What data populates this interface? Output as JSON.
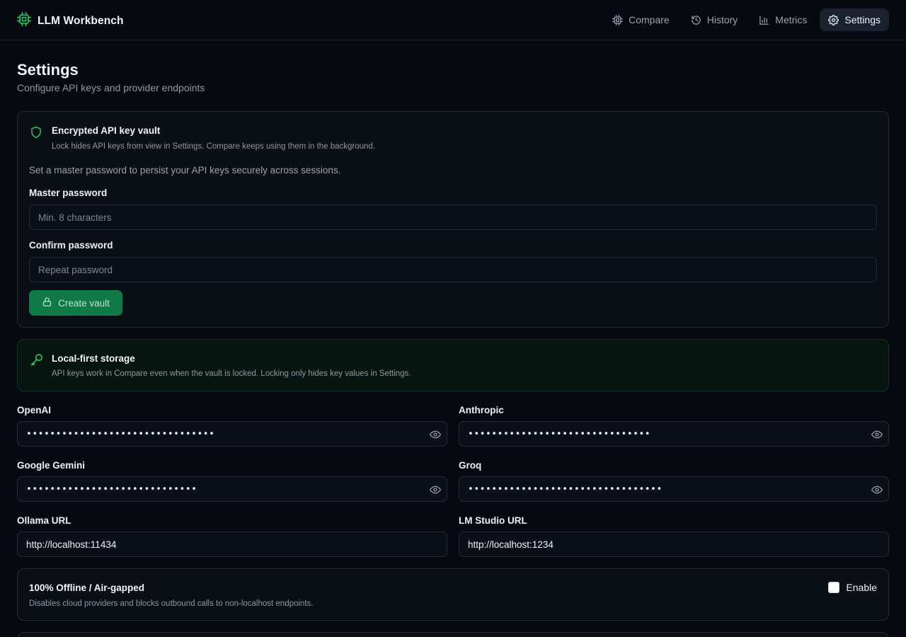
{
  "app": {
    "name": "LLM Workbench",
    "accent": "#22c55e"
  },
  "nav": {
    "items": [
      {
        "label": "Compare",
        "icon": "cpu-icon",
        "active": false
      },
      {
        "label": "History",
        "icon": "history-icon",
        "active": false
      },
      {
        "label": "Metrics",
        "icon": "bar-chart-icon",
        "active": false
      },
      {
        "label": "Settings",
        "icon": "gear-icon",
        "active": true
      }
    ]
  },
  "page": {
    "title": "Settings",
    "subtitle": "Configure API keys and provider endpoints"
  },
  "vault": {
    "title": "Encrypted API key vault",
    "description": "Lock hides API keys from view in Settings. Compare keeps using them in the background.",
    "intro": "Set a master password to persist your API keys securely across sessions.",
    "master_label": "Master password",
    "master_placeholder": "Min. 8 characters",
    "confirm_label": "Confirm password",
    "confirm_placeholder": "Repeat password",
    "create_label": "Create vault"
  },
  "local_storage": {
    "title": "Local-first storage",
    "description": "API keys work in Compare even when the vault is locked. Locking only hides key values in Settings."
  },
  "providers": {
    "openai": {
      "label": "OpenAI",
      "masked": "••••••••••••••••••••••••••••••••"
    },
    "anthropic": {
      "label": "Anthropic",
      "masked": "•••••••••••••••••••••••••••••••"
    },
    "gemini": {
      "label": "Google Gemini",
      "masked": "•••••••••••••••••••••••••••••"
    },
    "groq": {
      "label": "Groq",
      "masked": "•••••••••••••••••••••••••••••••••"
    },
    "ollama": {
      "label": "Ollama URL",
      "value": "http://localhost:11434"
    },
    "lmstudio": {
      "label": "LM Studio URL",
      "value": "http://localhost:1234"
    }
  },
  "offline": {
    "title": "100% Offline / Air-gapped",
    "description": "Disables cloud providers and blocks outbound calls to non-localhost endpoints.",
    "toggle_label": "Enable",
    "enabled": false
  }
}
